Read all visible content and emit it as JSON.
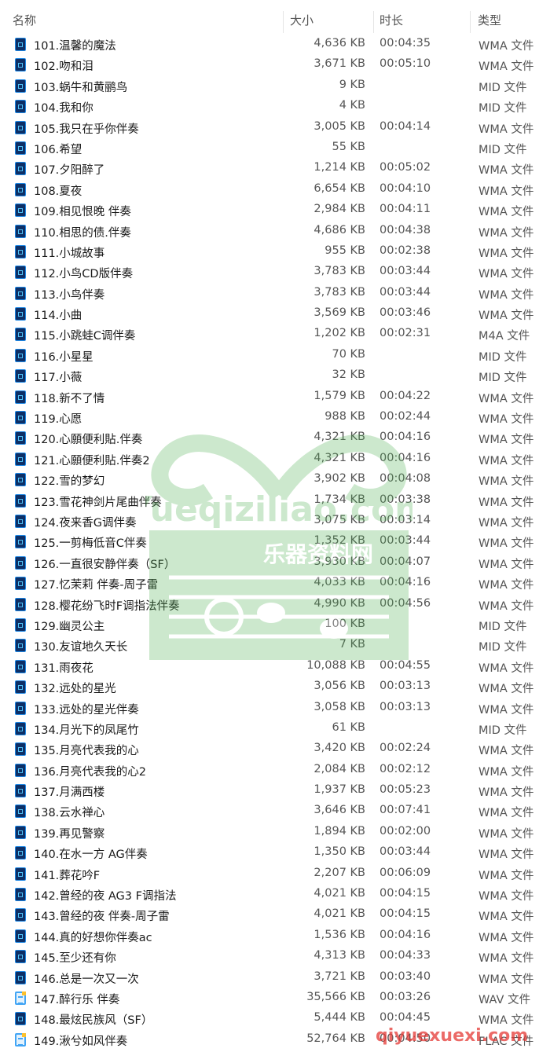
{
  "columns": {
    "name": "名称",
    "size": "大小",
    "duration": "时长",
    "type": "类型"
  },
  "watermarks": {
    "logo": "Yueqiziliao.com 乐器资料网",
    "corner": "qiyuexuexi.com"
  },
  "files": [
    {
      "name": "101.温馨的魔法",
      "size": "4,636 KB",
      "duration": "00:04:35",
      "type": "WMA 文件",
      "icon": "audio-file"
    },
    {
      "name": "102.吻和泪",
      "size": "3,671 KB",
      "duration": "00:05:10",
      "type": "WMA 文件",
      "icon": "audio-file"
    },
    {
      "name": "103.蜗牛和黄鹂鸟",
      "size": "9 KB",
      "duration": "",
      "type": "MID 文件",
      "icon": "audio-file"
    },
    {
      "name": "104.我和你",
      "size": "4 KB",
      "duration": "",
      "type": "MID 文件",
      "icon": "audio-file"
    },
    {
      "name": "105.我只在乎你伴奏",
      "size": "3,005 KB",
      "duration": "00:04:14",
      "type": "WMA 文件",
      "icon": "audio-file"
    },
    {
      "name": "106.希望",
      "size": "55 KB",
      "duration": "",
      "type": "MID 文件",
      "icon": "audio-file"
    },
    {
      "name": "107.夕阳醉了",
      "size": "1,214 KB",
      "duration": "00:05:02",
      "type": "WMA 文件",
      "icon": "audio-file"
    },
    {
      "name": "108.夏夜",
      "size": "6,654 KB",
      "duration": "00:04:10",
      "type": "WMA 文件",
      "icon": "audio-file"
    },
    {
      "name": "109.相见恨晚 伴奏",
      "size": "2,984 KB",
      "duration": "00:04:11",
      "type": "WMA 文件",
      "icon": "audio-file"
    },
    {
      "name": "110.相思的债.伴奏",
      "size": "4,686 KB",
      "duration": "00:04:38",
      "type": "WMA 文件",
      "icon": "audio-file"
    },
    {
      "name": "111.小城故事",
      "size": "955 KB",
      "duration": "00:02:38",
      "type": "WMA 文件",
      "icon": "audio-file"
    },
    {
      "name": "112.小鸟CD版伴奏",
      "size": "3,783 KB",
      "duration": "00:03:44",
      "type": "WMA 文件",
      "icon": "audio-file"
    },
    {
      "name": "113.小鸟伴奏",
      "size": "3,783 KB",
      "duration": "00:03:44",
      "type": "WMA 文件",
      "icon": "audio-file"
    },
    {
      "name": "114.小曲",
      "size": "3,569 KB",
      "duration": "00:03:46",
      "type": "WMA 文件",
      "icon": "audio-file"
    },
    {
      "name": "115.小跳蛙C调伴奏",
      "size": "1,202 KB",
      "duration": "00:02:31",
      "type": "M4A 文件",
      "icon": "audio-file"
    },
    {
      "name": "116.小星星",
      "size": "70 KB",
      "duration": "",
      "type": "MID 文件",
      "icon": "audio-file"
    },
    {
      "name": "117.小薇",
      "size": "32 KB",
      "duration": "",
      "type": "MID 文件",
      "icon": "audio-file"
    },
    {
      "name": "118.新不了情",
      "size": "1,579 KB",
      "duration": "00:04:22",
      "type": "WMA 文件",
      "icon": "audio-file"
    },
    {
      "name": "119.心愿",
      "size": "988 KB",
      "duration": "00:02:44",
      "type": "WMA 文件",
      "icon": "audio-file"
    },
    {
      "name": "120.心願便利貼.伴奏",
      "size": "4,321 KB",
      "duration": "00:04:16",
      "type": "WMA 文件",
      "icon": "audio-file"
    },
    {
      "name": "121.心願便利貼.伴奏2",
      "size": "4,321 KB",
      "duration": "00:04:16",
      "type": "WMA 文件",
      "icon": "audio-file"
    },
    {
      "name": "122.雪的梦幻",
      "size": "3,902 KB",
      "duration": "00:04:08",
      "type": "WMA 文件",
      "icon": "audio-file"
    },
    {
      "name": "123.雪花神剑片尾曲伴奏",
      "size": "1,734 KB",
      "duration": "00:03:38",
      "type": "WMA 文件",
      "icon": "audio-file"
    },
    {
      "name": "124.夜来香G调伴奏",
      "size": "3,075 KB",
      "duration": "00:03:14",
      "type": "WMA 文件",
      "icon": "audio-file"
    },
    {
      "name": "125.一剪梅低音C伴奏",
      "size": "1,352 KB",
      "duration": "00:03:44",
      "type": "WMA 文件",
      "icon": "audio-file"
    },
    {
      "name": "126.一直很安静伴奏（SF）",
      "size": "3,930 KB",
      "duration": "00:04:07",
      "type": "WMA 文件",
      "icon": "audio-file"
    },
    {
      "name": "127.忆茉莉 伴奏-周子雷",
      "size": "4,033 KB",
      "duration": "00:04:16",
      "type": "WMA 文件",
      "icon": "audio-file"
    },
    {
      "name": "128.樱花纷飞时F调指法伴奏",
      "size": "4,990 KB",
      "duration": "00:04:56",
      "type": "WMA 文件",
      "icon": "audio-file"
    },
    {
      "name": "129.幽灵公主",
      "size": "100 KB",
      "duration": "",
      "type": "MID 文件",
      "icon": "audio-file"
    },
    {
      "name": "130.友谊地久天长",
      "size": "7 KB",
      "duration": "",
      "type": "MID 文件",
      "icon": "audio-file"
    },
    {
      "name": "131.雨夜花",
      "size": "10,088 KB",
      "duration": "00:04:55",
      "type": "WMA 文件",
      "icon": "audio-file"
    },
    {
      "name": "132.远处的星光",
      "size": "3,056 KB",
      "duration": "00:03:13",
      "type": "WMA 文件",
      "icon": "audio-file"
    },
    {
      "name": "133.远处的星光伴奏",
      "size": "3,058 KB",
      "duration": "00:03:13",
      "type": "WMA 文件",
      "icon": "audio-file"
    },
    {
      "name": "134.月光下的凤尾竹",
      "size": "61 KB",
      "duration": "",
      "type": "MID 文件",
      "icon": "audio-file"
    },
    {
      "name": "135.月亮代表我的心",
      "size": "3,420 KB",
      "duration": "00:02:24",
      "type": "WMA 文件",
      "icon": "audio-file"
    },
    {
      "name": "136.月亮代表我的心2",
      "size": "2,084 KB",
      "duration": "00:02:12",
      "type": "WMA 文件",
      "icon": "audio-file"
    },
    {
      "name": "137.月满西楼",
      "size": "1,937 KB",
      "duration": "00:05:23",
      "type": "WMA 文件",
      "icon": "audio-file"
    },
    {
      "name": "138.云水禅心",
      "size": "3,646 KB",
      "duration": "00:07:41",
      "type": "WMA 文件",
      "icon": "audio-file"
    },
    {
      "name": "139.再见警察",
      "size": "1,894 KB",
      "duration": "00:02:00",
      "type": "WMA 文件",
      "icon": "audio-file"
    },
    {
      "name": "140.在水一方 AG伴奏",
      "size": "1,350 KB",
      "duration": "00:03:44",
      "type": "WMA 文件",
      "icon": "audio-file"
    },
    {
      "name": "141.葬花吟F",
      "size": "2,207 KB",
      "duration": "00:06:09",
      "type": "WMA 文件",
      "icon": "audio-file"
    },
    {
      "name": "142.曾经的夜 AG3 F调指法",
      "size": "4,021 KB",
      "duration": "00:04:15",
      "type": "WMA 文件",
      "icon": "audio-file"
    },
    {
      "name": "143.曾经的夜 伴奏-周子雷",
      "size": "4,021 KB",
      "duration": "00:04:15",
      "type": "WMA 文件",
      "icon": "audio-file"
    },
    {
      "name": "144.真的好想你伴奏ac",
      "size": "1,536 KB",
      "duration": "00:04:16",
      "type": "WMA 文件",
      "icon": "audio-file"
    },
    {
      "name": "145.至少还有你",
      "size": "4,313 KB",
      "duration": "00:04:33",
      "type": "WMA 文件",
      "icon": "audio-file"
    },
    {
      "name": "146.总是一次又一次",
      "size": "3,721 KB",
      "duration": "00:03:40",
      "type": "WMA 文件",
      "icon": "audio-file"
    },
    {
      "name": "147.醉行乐 伴奏",
      "size": "35,566 KB",
      "duration": "00:03:26",
      "type": "WAV 文件",
      "icon": "lossless-audio-file"
    },
    {
      "name": "148.最炫民族风（SF）",
      "size": "5,444 KB",
      "duration": "00:04:45",
      "type": "WMA 文件",
      "icon": "audio-file"
    },
    {
      "name": "149.湫兮如风伴奏",
      "size": "52,764 KB",
      "duration": "00:04:50",
      "type": "FLAC 文件",
      "icon": "lossless-audio-file"
    }
  ]
}
